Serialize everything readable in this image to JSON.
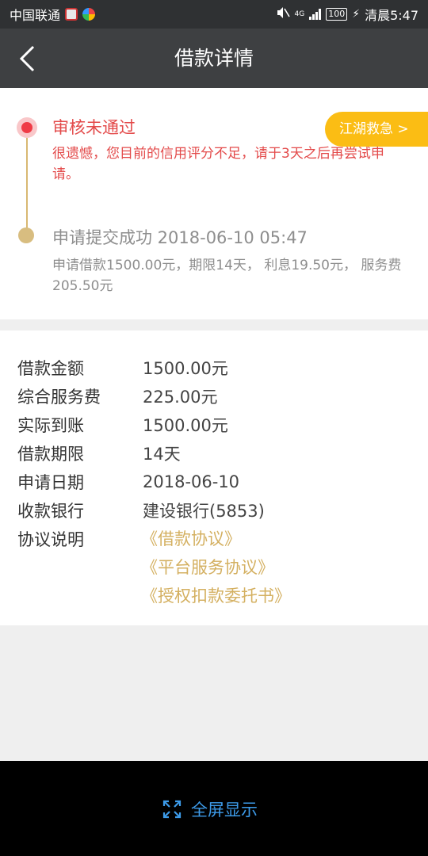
{
  "statusbar": {
    "carrier": "中国联通",
    "signal_tag": "4G",
    "battery": "100",
    "time": "清晨5:47"
  },
  "nav": {
    "title": "借款详情"
  },
  "timeline": {
    "rejected_title": "审核未通过",
    "rejected_desc": "很遗憾，您目前的信用评分不足，请于3天之后再尝试申请。",
    "rescue_button": "江湖救急 >",
    "submitted_title": "申请提交成功 2018-06-10 05:47",
    "submitted_desc": "申请借款1500.00元，期限14天， 利息19.50元， 服务费205.50元"
  },
  "details": {
    "rows": [
      {
        "label": "借款金额",
        "value": "1500.00元"
      },
      {
        "label": "综合服务费",
        "value": "225.00元"
      },
      {
        "label": "实际到账",
        "value": "1500.00元"
      },
      {
        "label": "借款期限",
        "value": "14天"
      },
      {
        "label": "申请日期",
        "value": "2018-06-10"
      },
      {
        "label": "收款银行",
        "value": "建设银行(5853)"
      }
    ],
    "agreement_label": "协议说明",
    "agreements": [
      "《借款协议》",
      "《平台服务协议》",
      "《授权扣款委托书》"
    ]
  },
  "bottom": {
    "fullscreen_label": "全屏显示"
  },
  "colors": {
    "accent_gold": "#d4b061",
    "error_red": "#e34a4a",
    "rescue_yellow": "#fbbd14",
    "link_blue": "#3d9be9"
  }
}
